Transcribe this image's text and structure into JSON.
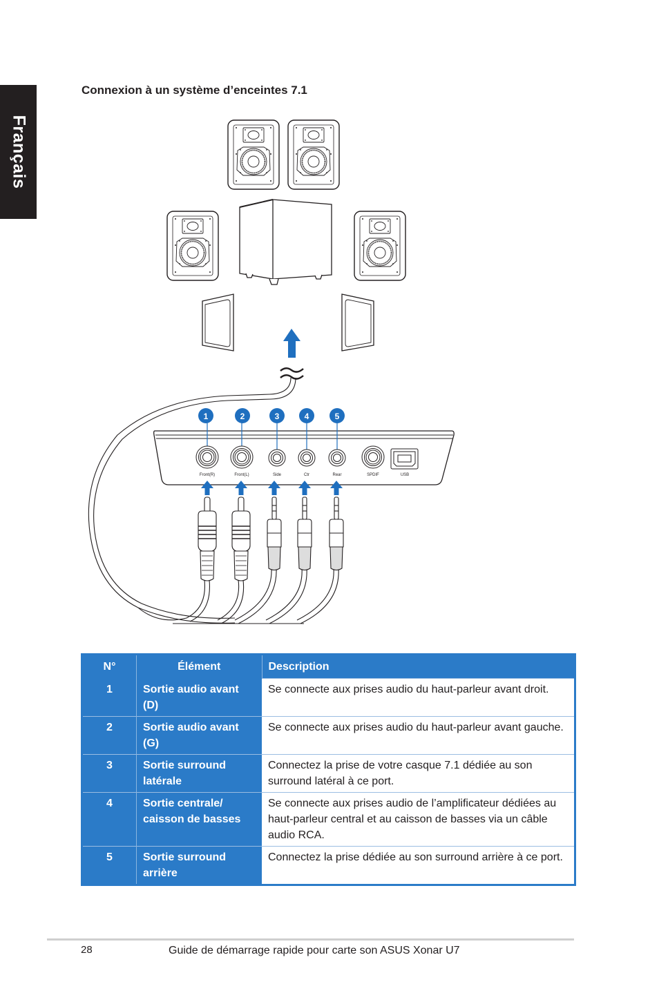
{
  "side_tab": {
    "label": "Français"
  },
  "section": {
    "title": "Connexion à un système d’enceintes 7.1"
  },
  "diagram": {
    "accent_color": "#1f6fbf",
    "badges": [
      "1",
      "2",
      "3",
      "4",
      "5"
    ],
    "ports": [
      "Front(R)",
      "Front(L)",
      "Side",
      "Ctr",
      "Rear",
      "SPDIF",
      "USB"
    ],
    "icons": [
      "speaker-icon",
      "subwoofer-icon",
      "surround-panel-icon",
      "arrow-up-icon",
      "cable-break-icon",
      "rca-plug-icon",
      "mini-jack-plug-icon",
      "usb-port-icon"
    ]
  },
  "table": {
    "header_color": "#2b7bc8",
    "headers": {
      "no": "N°",
      "element": "Élément",
      "description": "Description"
    },
    "rows": [
      {
        "no": "1",
        "element": "Sortie audio avant (D)",
        "description": "Se connecte aux prises audio du haut-parleur avant droit."
      },
      {
        "no": "2",
        "element": "Sortie audio avant (G)",
        "description": "Se connecte aux prises audio du haut-parleur avant gauche."
      },
      {
        "no": "3",
        "element": "Sortie surround latérale",
        "description": "Connectez la prise de votre casque 7.1 dédiée au son surround latéral à ce port."
      },
      {
        "no": "4",
        "element": "Sortie centrale/ caisson de basses",
        "description": "Se connecte aux prises audio de l’amplificateur dédiées au haut-parleur central et au caisson de basses via un câble audio RCA."
      },
      {
        "no": "5",
        "element": "Sortie surround arrière",
        "description": "Connectez la prise dédiée au son surround arrière à ce port."
      }
    ]
  },
  "footer": {
    "page_number": "28",
    "text": "Guide de démarrage rapide pour carte son ASUS Xonar U7"
  }
}
